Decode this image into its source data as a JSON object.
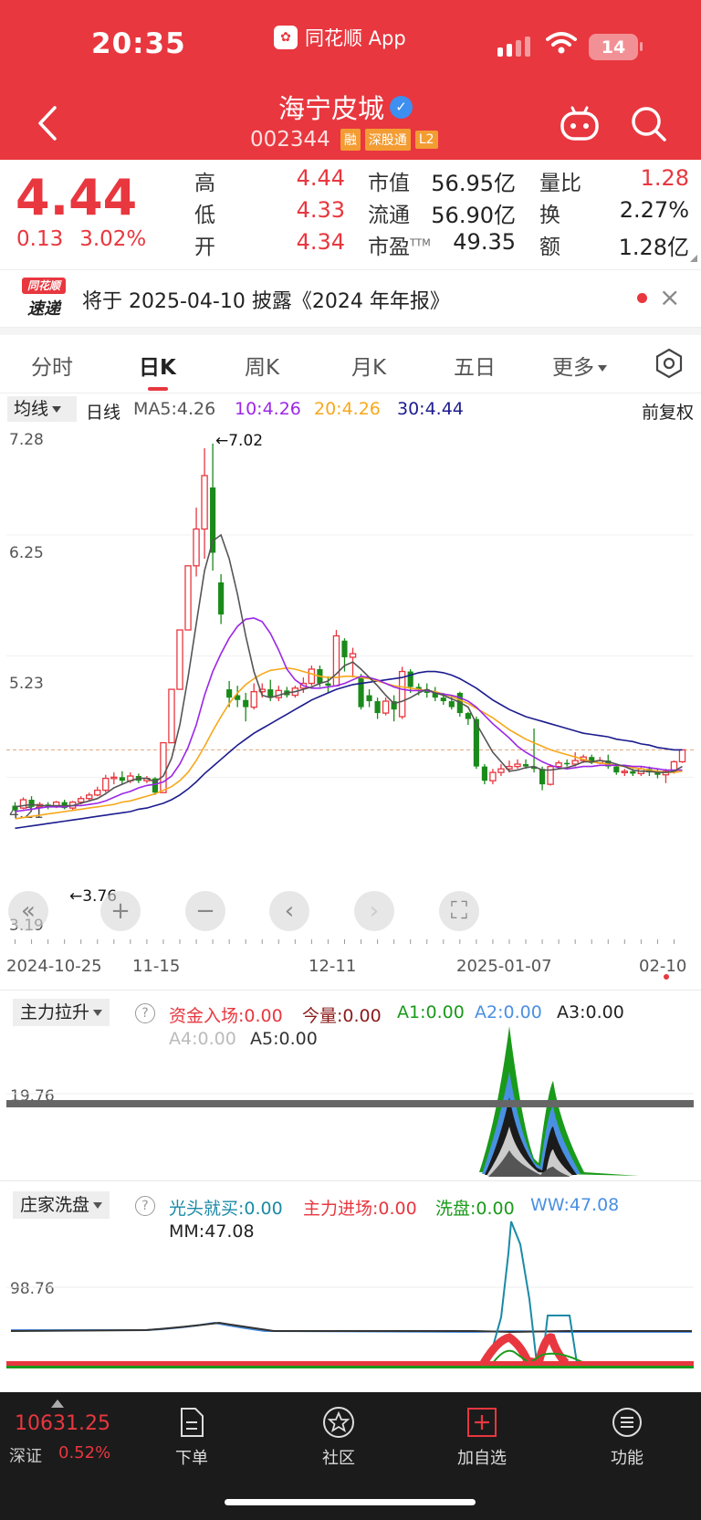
{
  "status": {
    "time": "20:35",
    "app_name": "同花顺 App",
    "battery": "14"
  },
  "stock": {
    "name": "海宁皮城",
    "code": "002344",
    "tags": [
      "融",
      "深股通",
      "L2"
    ],
    "price": "4.44",
    "change": "0.13",
    "change_pct": "3.02%"
  },
  "quote": {
    "high_label": "高",
    "high": "4.44",
    "low_label": "低",
    "low": "4.33",
    "open_label": "开",
    "open": "4.34",
    "mcap_label": "市值",
    "mcap": "56.95亿",
    "float_label": "流通",
    "float": "56.90亿",
    "pe_label": "市盈",
    "pe_sup": "TTM",
    "pe": "49.35",
    "vr_label": "量比",
    "vr": "1.28",
    "turn_label": "换",
    "turn": "2.27%",
    "amt_label": "额",
    "amt": "1.28亿"
  },
  "news": {
    "logo_top": "同花顺",
    "logo_bottom": "速递",
    "text": "将于 2025-04-10 披露《2024 年年报》"
  },
  "tabs": [
    "分时",
    "日K",
    "周K",
    "月K",
    "五日",
    "更多"
  ],
  "ma": {
    "selector": "均线",
    "period": "日线",
    "ma5": "MA5:4.26",
    "ma10": "10:4.26",
    "ma20": "20:4.26",
    "ma30": "30:4.44",
    "adjust": "前复权",
    "colors": {
      "ma5": "#555555",
      "ma10": "#9b27e6",
      "ma20": "#f7a81b",
      "ma30": "#1c1c8f"
    }
  },
  "kline": {
    "y_labels": [
      "7.28",
      "6.25",
      "5.23",
      "4.21",
      "3.19"
    ],
    "high_marker": "←7.02",
    "low_marker": "←3.76",
    "dates": [
      "2024-10-25",
      "11-15",
      "12-11",
      "2025-01-07",
      "02-10"
    ],
    "candles": [
      [
        3.97,
        3.93,
        4.0,
        3.92
      ],
      [
        3.95,
        4.02,
        4.04,
        3.94
      ],
      [
        4.02,
        3.96,
        4.05,
        3.95
      ],
      [
        3.96,
        3.98,
        4.0,
        3.95
      ],
      [
        3.98,
        3.96,
        4.0,
        3.94
      ],
      [
        3.96,
        4.0,
        4.01,
        3.95
      ],
      [
        4.0,
        3.95,
        4.02,
        3.94
      ],
      [
        3.95,
        4.0,
        4.01,
        3.93
      ],
      [
        4.0,
        4.03,
        4.05,
        3.98
      ],
      [
        4.03,
        4.06,
        4.08,
        4.01
      ],
      [
        4.06,
        4.1,
        4.13,
        4.05
      ],
      [
        4.1,
        4.2,
        4.23,
        4.08
      ],
      [
        4.2,
        4.21,
        4.25,
        4.15
      ],
      [
        4.21,
        4.18,
        4.26,
        4.15
      ],
      [
        4.18,
        4.22,
        4.25,
        4.16
      ],
      [
        4.22,
        4.18,
        4.24,
        4.16
      ],
      [
        4.18,
        4.2,
        4.22,
        4.16
      ],
      [
        4.2,
        4.08,
        4.21,
        4.06
      ],
      [
        4.08,
        4.5,
        4.5,
        4.08
      ],
      [
        4.5,
        4.95,
        4.95,
        4.5
      ],
      [
        4.95,
        5.45,
        5.45,
        4.95
      ],
      [
        5.45,
        5.99,
        5.99,
        5.45
      ],
      [
        5.99,
        6.3,
        6.48,
        5.9
      ],
      [
        6.3,
        6.75,
        6.98,
        6.05
      ],
      [
        6.65,
        6.1,
        7.02,
        5.95
      ],
      [
        5.85,
        5.58,
        5.92,
        5.5
      ],
      [
        4.95,
        4.88,
        5.02,
        4.8
      ],
      [
        4.9,
        4.86,
        4.98,
        4.8
      ],
      [
        4.86,
        4.8,
        4.92,
        4.68
      ],
      [
        4.8,
        4.93,
        5.0,
        4.78
      ],
      [
        4.93,
        4.95,
        5.0,
        4.88
      ],
      [
        4.95,
        4.88,
        5.03,
        4.85
      ],
      [
        4.88,
        4.94,
        4.98,
        4.85
      ],
      [
        4.94,
        4.9,
        4.97,
        4.88
      ],
      [
        4.9,
        4.96,
        4.98,
        4.88
      ],
      [
        4.96,
        5.0,
        5.05,
        4.92
      ],
      [
        5.0,
        5.12,
        5.15,
        4.98
      ],
      [
        5.12,
        5.0,
        5.15,
        4.97
      ],
      [
        5.0,
        4.98,
        5.06,
        4.92
      ],
      [
        4.98,
        5.4,
        5.45,
        4.98
      ],
      [
        5.36,
        5.22,
        5.38,
        5.1
      ],
      [
        5.22,
        5.25,
        5.3,
        5.05
      ],
      [
        5.05,
        4.8,
        5.08,
        4.78
      ],
      [
        4.9,
        4.85,
        4.95,
        4.8
      ],
      [
        4.85,
        4.75,
        4.88,
        4.7
      ],
      [
        4.75,
        4.85,
        4.88,
        4.73
      ],
      [
        4.85,
        4.78,
        4.9,
        4.68
      ],
      [
        4.72,
        5.1,
        5.14,
        4.7
      ],
      [
        5.1,
        4.97,
        5.12,
        4.92
      ],
      [
        4.97,
        4.95,
        5.0,
        4.9
      ],
      [
        4.95,
        4.92,
        5.0,
        4.88
      ],
      [
        4.92,
        4.88,
        4.97,
        4.85
      ],
      [
        4.88,
        4.85,
        4.92,
        4.82
      ],
      [
        4.85,
        4.8,
        4.9,
        4.78
      ],
      [
        4.92,
        4.75,
        4.93,
        4.72
      ],
      [
        4.75,
        4.7,
        4.76,
        4.65
      ],
      [
        4.7,
        4.3,
        4.72,
        4.28
      ],
      [
        4.3,
        4.18,
        4.32,
        4.15
      ],
      [
        4.18,
        4.25,
        4.28,
        4.15
      ],
      [
        4.25,
        4.28,
        4.32,
        4.22
      ],
      [
        4.28,
        4.3,
        4.35,
        4.25
      ],
      [
        4.3,
        4.32,
        4.36,
        4.28
      ],
      [
        4.32,
        4.3,
        4.36,
        4.28
      ],
      [
        4.3,
        4.28,
        4.62,
        4.25
      ],
      [
        4.28,
        4.15,
        4.3,
        4.1
      ],
      [
        4.15,
        4.3,
        4.32,
        4.14
      ],
      [
        4.3,
        4.33,
        4.35,
        4.28
      ],
      [
        4.33,
        4.32,
        4.36,
        4.3
      ],
      [
        4.32,
        4.35,
        4.42,
        4.3
      ],
      [
        4.35,
        4.38,
        4.4,
        4.33
      ],
      [
        4.38,
        4.33,
        4.4,
        4.32
      ],
      [
        4.33,
        4.35,
        4.38,
        4.32
      ],
      [
        4.35,
        4.3,
        4.4,
        4.28
      ],
      [
        4.3,
        4.25,
        4.32,
        4.23
      ],
      [
        4.25,
        4.26,
        4.28,
        4.22
      ],
      [
        4.26,
        4.24,
        4.28,
        4.22
      ],
      [
        4.24,
        4.28,
        4.3,
        4.22
      ],
      [
        4.28,
        4.25,
        4.3,
        4.22
      ],
      [
        4.25,
        4.23,
        4.28,
        4.2
      ],
      [
        4.23,
        4.26,
        4.28,
        4.16
      ],
      [
        4.26,
        4.34,
        4.35,
        4.24
      ],
      [
        4.34,
        4.44,
        4.44,
        4.33
      ]
    ],
    "ma5": [
      3.96,
      3.97,
      3.98,
      3.97,
      3.97,
      3.97,
      3.97,
      3.97,
      3.99,
      4.01,
      4.03,
      4.07,
      4.12,
      4.15,
      4.18,
      4.2,
      4.2,
      4.17,
      4.22,
      4.37,
      4.65,
      5.05,
      5.5,
      5.95,
      6.2,
      6.25,
      6.05,
      5.75,
      5.4,
      5.1,
      4.9,
      4.88,
      4.9,
      4.92,
      4.93,
      4.95,
      4.97,
      5.0,
      5.02,
      5.08,
      5.15,
      5.18,
      5.12,
      5.05,
      4.98,
      4.9,
      4.83,
      4.85,
      4.88,
      4.92,
      4.95,
      4.92,
      4.9,
      4.87,
      4.84,
      4.8,
      4.66,
      4.54,
      4.42,
      4.34,
      4.26,
      4.27,
      4.29,
      4.3,
      4.27,
      4.27,
      4.28,
      4.29,
      4.31,
      4.34,
      4.34,
      4.35,
      4.34,
      4.32,
      4.3,
      4.27,
      4.26,
      4.26,
      4.25,
      4.25,
      4.26,
      4.3
    ],
    "ma10": [
      3.92,
      3.93,
      3.94,
      3.95,
      3.96,
      3.96,
      3.96,
      3.97,
      3.97,
      3.98,
      3.99,
      4.01,
      4.04,
      4.07,
      4.09,
      4.12,
      4.14,
      4.15,
      4.17,
      4.22,
      4.32,
      4.46,
      4.65,
      4.9,
      5.1,
      5.25,
      5.38,
      5.48,
      5.54,
      5.55,
      5.52,
      5.42,
      5.28,
      5.12,
      5.03,
      4.98,
      4.96,
      4.96,
      4.97,
      4.98,
      5.0,
      5.03,
      5.06,
      5.05,
      5.03,
      5.0,
      4.97,
      4.95,
      4.94,
      4.94,
      4.94,
      4.92,
      4.91,
      4.9,
      4.88,
      4.85,
      4.8,
      4.73,
      4.66,
      4.6,
      4.54,
      4.47,
      4.42,
      4.38,
      4.34,
      4.31,
      4.29,
      4.28,
      4.29,
      4.3,
      4.3,
      4.31,
      4.31,
      4.31,
      4.31,
      4.3,
      4.3,
      4.29,
      4.28,
      4.27,
      4.27,
      4.27
    ],
    "ma20": [
      3.86,
      3.87,
      3.88,
      3.89,
      3.9,
      3.91,
      3.92,
      3.93,
      3.94,
      3.95,
      3.96,
      3.97,
      3.98,
      4.0,
      4.01,
      4.03,
      4.05,
      4.07,
      4.1,
      4.13,
      4.18,
      4.25,
      4.35,
      4.47,
      4.6,
      4.72,
      4.83,
      4.92,
      4.99,
      5.04,
      5.08,
      5.11,
      5.12,
      5.13,
      5.12,
      5.1,
      5.08,
      5.06,
      5.05,
      5.05,
      5.06,
      5.06,
      5.05,
      5.04,
      5.02,
      5.0,
      4.98,
      4.97,
      4.96,
      4.95,
      4.94,
      4.93,
      4.91,
      4.89,
      4.86,
      4.83,
      4.79,
      4.75,
      4.71,
      4.66,
      4.61,
      4.57,
      4.53,
      4.5,
      4.47,
      4.44,
      4.42,
      4.4,
      4.38,
      4.36,
      4.34,
      4.33,
      4.32,
      4.31,
      4.3,
      4.29,
      4.28,
      4.27,
      4.26,
      4.25,
      4.25,
      4.26
    ],
    "ma30": [
      3.78,
      3.79,
      3.8,
      3.81,
      3.82,
      3.83,
      3.84,
      3.85,
      3.86,
      3.87,
      3.88,
      3.89,
      3.9,
      3.91,
      3.92,
      3.94,
      3.95,
      3.97,
      3.99,
      4.02,
      4.06,
      4.11,
      4.17,
      4.24,
      4.3,
      4.36,
      4.42,
      4.48,
      4.53,
      4.58,
      4.62,
      4.66,
      4.7,
      4.74,
      4.78,
      4.82,
      4.86,
      4.89,
      4.92,
      4.95,
      4.97,
      4.99,
      5.0,
      5.01,
      5.02,
      5.03,
      5.04,
      5.05,
      5.07,
      5.09,
      5.1,
      5.1,
      5.09,
      5.07,
      5.04,
      5.0,
      4.96,
      4.91,
      4.86,
      4.82,
      4.78,
      4.75,
      4.72,
      4.7,
      4.68,
      4.66,
      4.64,
      4.62,
      4.6,
      4.58,
      4.57,
      4.56,
      4.55,
      4.53,
      4.52,
      4.51,
      4.49,
      4.48,
      4.46,
      4.45,
      4.44,
      4.44
    ]
  },
  "ind1": {
    "selector": "主力拉升",
    "labels": [
      {
        "text": "资金入场:0.00",
        "color": "#e8373f"
      },
      {
        "text": "今量:0.00",
        "color": "#8b1a1a"
      },
      {
        "text": "A1:0.00",
        "color": "#1a9a1a"
      },
      {
        "text": "A2:0.00",
        "color": "#4a90e2"
      },
      {
        "text": "A3:0.00",
        "color": "#222222"
      },
      {
        "text": "A4:0.00",
        "color": "#bbbbbb"
      },
      {
        "text": "A5:0.00",
        "color": "#333333"
      }
    ],
    "axis": "19.76"
  },
  "ind2": {
    "selector": "庄家洗盘",
    "labels": [
      {
        "text": "光头就买:0.00",
        "color": "#1a8aa6"
      },
      {
        "text": "主力进场:0.00",
        "color": "#e8373f"
      },
      {
        "text": "洗盘:0.00",
        "color": "#1a9a1a"
      },
      {
        "text": "WW:47.08",
        "color": "#4a90e2"
      },
      {
        "text": "MM:47.08",
        "color": "#222222"
      }
    ],
    "axis": "98.76"
  },
  "bottom": {
    "index_value": "10631.25",
    "index_name": "深证",
    "index_pct": "0.52%",
    "nav": [
      "下单",
      "社区",
      "加自选",
      "功能"
    ]
  }
}
